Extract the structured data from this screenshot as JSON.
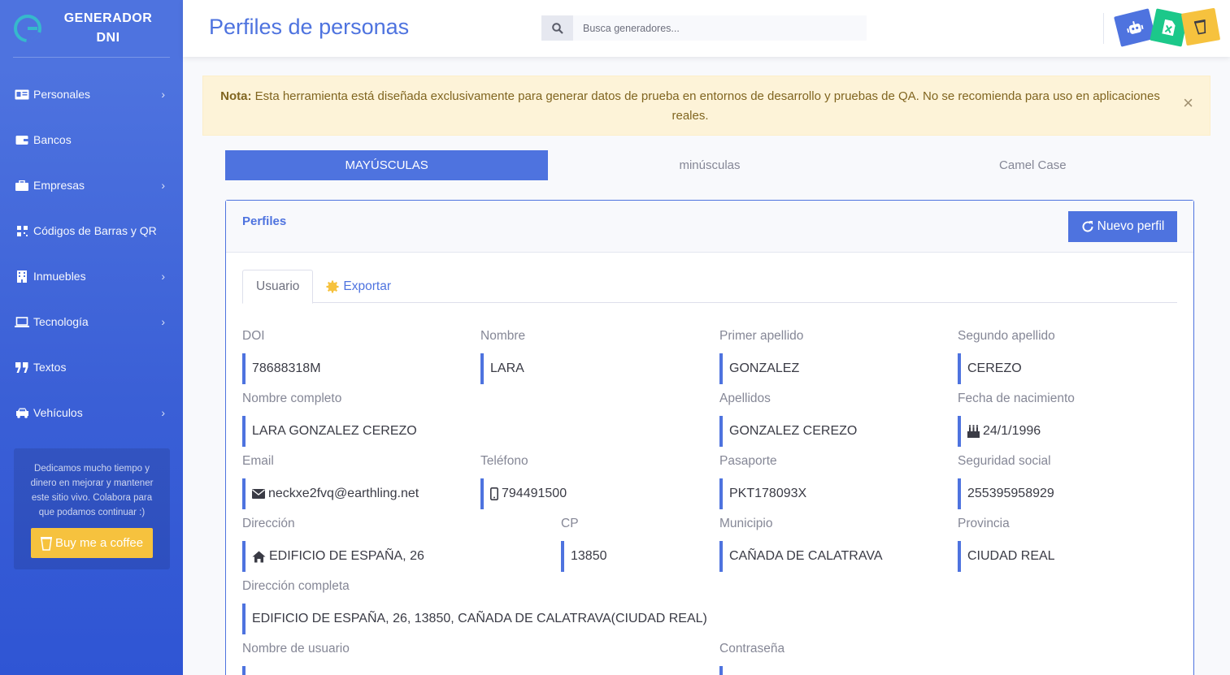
{
  "brand": {
    "name": "GENERADOR DNI"
  },
  "sidebar": {
    "items": [
      {
        "label": "Personales",
        "icon": "id-card-icon",
        "has_chevron": true
      },
      {
        "label": "Bancos",
        "icon": "wallet-icon",
        "has_chevron": false
      },
      {
        "label": "Empresas",
        "icon": "briefcase-icon",
        "has_chevron": true
      },
      {
        "label": "Códigos de Barras y QR",
        "icon": "qrcode-icon",
        "has_chevron": false
      },
      {
        "label": "Inmuebles",
        "icon": "building-icon",
        "has_chevron": true
      },
      {
        "label": "Tecnología",
        "icon": "laptop-icon",
        "has_chevron": true
      },
      {
        "label": "Textos",
        "icon": "quote-icon",
        "has_chevron": false
      },
      {
        "label": "Vehículos",
        "icon": "car-icon",
        "has_chevron": true
      }
    ],
    "donate_text": "Dedicamos mucho tiempo y dinero en mejorar y mantener este sitio vivo. Colabora para que podamos continuar :)",
    "donate_button": "Buy me a coffee"
  },
  "topbar": {
    "title": "Perfiles de personas",
    "search_placeholder": "Busca generadores..."
  },
  "alert": {
    "strong": "Nota:",
    "text": " Esta herramienta está diseñada exclusivamente para generar datos de prueba en entornos de desarrollo y pruebas de QA. No se recomienda para uso en aplicaciones reales.",
    "close": "×"
  },
  "case_tabs": [
    "MAYÚSCULAS",
    "minúsculas",
    "Camel Case"
  ],
  "card": {
    "title": "Perfiles",
    "new_button": "Nuevo perfil",
    "tabs": [
      "Usuario",
      "Exportar"
    ]
  },
  "profile": {
    "doi": {
      "label": "DOI",
      "value": "78688318M"
    },
    "nombre": {
      "label": "Nombre",
      "value": "LARA"
    },
    "primer_apellido": {
      "label": "Primer apellido",
      "value": "GONZALEZ"
    },
    "segundo_apellido": {
      "label": "Segundo apellido",
      "value": "CEREZO"
    },
    "nombre_completo": {
      "label": "Nombre completo",
      "value": "LARA GONZALEZ CEREZO"
    },
    "apellidos": {
      "label": "Apellidos",
      "value": "GONZALEZ CEREZO"
    },
    "fecha_nacimiento": {
      "label": "Fecha de nacimiento",
      "value": "24/1/1996"
    },
    "email": {
      "label": "Email",
      "value": "neckxe2fvq@earthling.net"
    },
    "telefono": {
      "label": "Teléfono",
      "value": "794491500"
    },
    "pasaporte": {
      "label": "Pasaporte",
      "value": "PKT178093X"
    },
    "seguridad_social": {
      "label": "Seguridad social",
      "value": "255395958929"
    },
    "direccion": {
      "label": "Dirección",
      "value": "EDIFICIO DE ESPAÑA, 26"
    },
    "cp": {
      "label": "CP",
      "value": "13850"
    },
    "municipio": {
      "label": "Municipio",
      "value": "CAÑADA DE CALATRAVA"
    },
    "provincia": {
      "label": "Provincia",
      "value": "CIUDAD REAL"
    },
    "direccion_completa": {
      "label": "Dirección completa",
      "value": "EDIFICIO DE ESPAÑA, 26, 13850, CAÑADA DE CALATRAVA(CIUDAD REAL)"
    },
    "nombre_usuario": {
      "label": "Nombre de usuario",
      "value": ""
    },
    "contrasena": {
      "label": "Contraseña",
      "value": ""
    }
  },
  "colors": {
    "primary": "#4e73df",
    "warning": "#f6c23e",
    "success": "#1cc88a"
  }
}
